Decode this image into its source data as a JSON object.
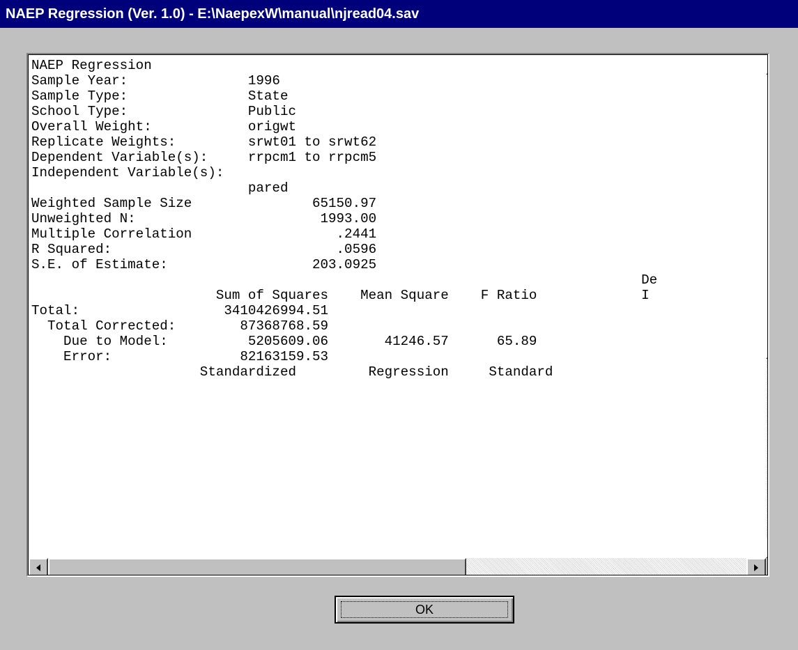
{
  "window": {
    "title": "NAEP Regression (Ver. 1.0) - E:\\NaepexW\\manual\\njread04.sav"
  },
  "report": {
    "lines": [
      "NAEP Regression",
      "",
      "Sample Year:               1996",
      "Sample Type:               State",
      "School Type:               Public",
      "Overall Weight:            origwt",
      "Replicate Weights:         srwt01 to srwt62",
      "Dependent Variable(s):     rrpcm1 to rrpcm5",
      "Independent Variable(s):",
      "                           pared",
      "",
      "",
      "Weighted Sample Size               65150.97",
      "Unweighted N:                       1993.00",
      "",
      "Multiple Correlation                  .2441",
      "R Squared:                            .0596",
      "S.E. of Estimate:                  203.0925",
      "",
      "                                                                            De",
      "                       Sum of Squares    Mean Square    F Ratio             I",
      "Total:                  3410426994.51",
      "  Total Corrected:        87368768.59",
      "    Due to Model:          5205609.06       41246.57      65.89",
      "    Error:                82163159.53",
      "",
      "",
      "",
      "                     Standardized         Regression     Standard"
    ]
  },
  "buttons": {
    "ok": "OK"
  },
  "icons": {
    "scroll_up": "arrow-up-icon",
    "scroll_down": "arrow-down-icon",
    "scroll_left": "arrow-left-icon",
    "scroll_right": "arrow-right-icon"
  }
}
